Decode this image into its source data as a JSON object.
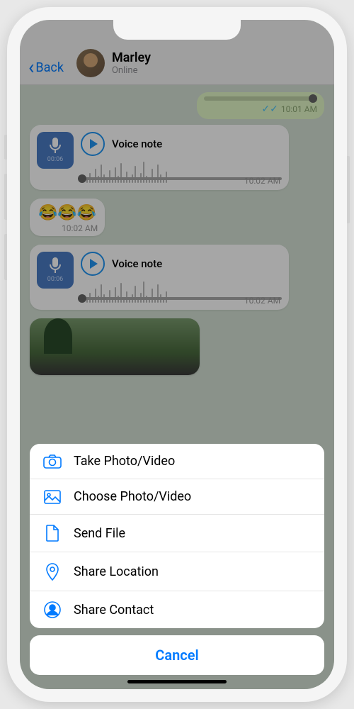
{
  "header": {
    "back_label": "Back",
    "contact_name": "Marley",
    "contact_status": "Online"
  },
  "messages": {
    "out_time_1": "10:01 AM",
    "voice_label": "Voice note",
    "voice_duration": "00:06",
    "voice_time_1": "10:02 AM",
    "emoji_text": "😂😂😂",
    "emoji_time": "10:02 AM",
    "voice_time_2": "10:02 AM"
  },
  "sheet": {
    "take_photo": "Take Photo/Video",
    "choose_photo": "Choose Photo/Video",
    "send_file": "Send File",
    "share_location": "Share Location",
    "share_contact": "Share Contact",
    "cancel": "Cancel"
  }
}
